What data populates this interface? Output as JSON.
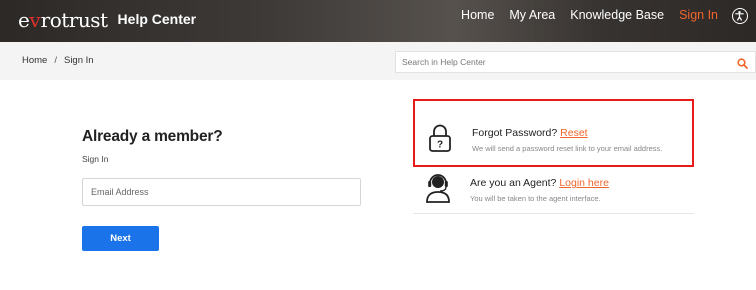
{
  "header": {
    "logo": {
      "part1": "e",
      "part2": "v",
      "part3": "rotrust",
      "sub": "Help Center"
    },
    "nav": [
      {
        "label": "Home"
      },
      {
        "label": "My Area"
      },
      {
        "label": "Knowledge Base"
      },
      {
        "label": "Sign In",
        "active": true
      }
    ],
    "accessibility_icon": "accessibility-icon"
  },
  "breadcrumb": {
    "items": [
      "Home",
      "Sign In"
    ],
    "separator": "/"
  },
  "search": {
    "placeholder": "Search in Help Center",
    "icon": "search-icon"
  },
  "login": {
    "title": "Already a member?",
    "subtitle": "Sign In",
    "email_placeholder": "Email Address",
    "next_label": "Next"
  },
  "options": {
    "forgot": {
      "title": "Forgot Password?",
      "link": "Reset",
      "desc": "We will send a password reset link to your email address.",
      "icon": "lock-icon",
      "highlighted": true
    },
    "agent": {
      "title": "Are you an Agent?",
      "link": "Login here",
      "desc": "You will be taken to the agent interface.",
      "icon": "headset-agent-icon"
    }
  },
  "colors": {
    "accent": "#f0652b",
    "primary_button": "#1a73e8",
    "highlight_border": "#e81b1b",
    "logo_v": "#e0302a"
  }
}
